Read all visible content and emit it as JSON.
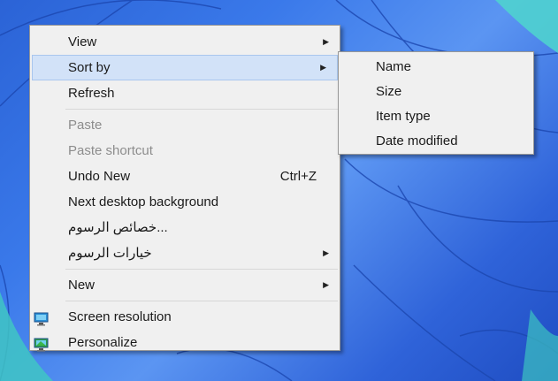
{
  "main_menu": {
    "items": [
      {
        "label": "View",
        "has_submenu": true
      },
      {
        "label": "Sort by",
        "has_submenu": true,
        "highlighted": true
      },
      {
        "label": "Refresh"
      },
      {
        "label": "Paste",
        "disabled": true
      },
      {
        "label": "Paste shortcut",
        "disabled": true
      },
      {
        "label": "Undo New",
        "shortcut": "Ctrl+Z"
      },
      {
        "label": "Next desktop background"
      },
      {
        "label": "...خصائص الرسوم"
      },
      {
        "label": "خيارات الرسوم",
        "has_submenu": true
      },
      {
        "label": "New",
        "has_submenu": true
      },
      {
        "label": "Screen resolution",
        "icon": "display-icon"
      },
      {
        "label": "Personalize",
        "icon": "personalize-icon"
      }
    ]
  },
  "sort_submenu": {
    "items": [
      {
        "label": "Name"
      },
      {
        "label": "Size"
      },
      {
        "label": "Item type"
      },
      {
        "label": "Date modified"
      }
    ]
  },
  "colors": {
    "menu_bg": "#f0f0f0",
    "highlight_bg": "#d2e2f8",
    "highlight_border": "#a9c6ee",
    "disabled_text": "#8d8d8d",
    "desktop_blue": "#3a79ea"
  }
}
